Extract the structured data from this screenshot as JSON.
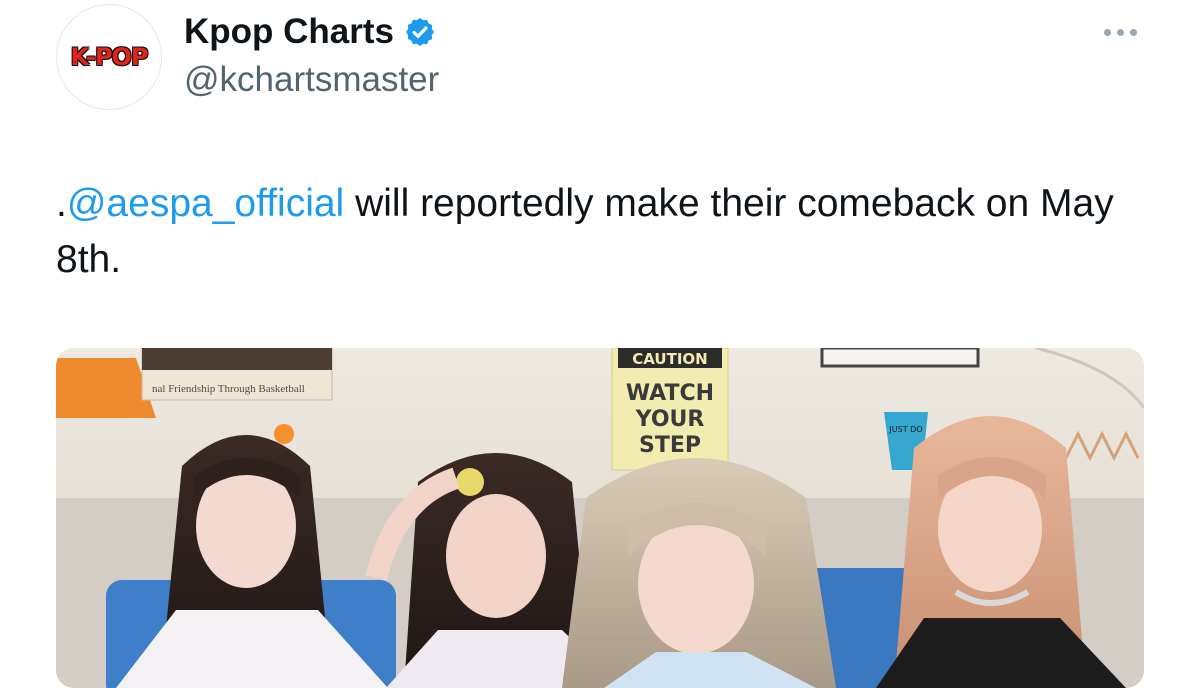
{
  "tweet": {
    "avatar_text": "K-POP",
    "display_name": "Kpop Charts",
    "handle": "@kchartsmaster",
    "text_prefix": ".",
    "mention": "@aespa_official",
    "text_rest": " will reportedly make their comeback on May 8th.",
    "icons": {
      "verified": "verified-badge-icon",
      "more": "more-options-icon"
    }
  },
  "media": {
    "sign_top": "CAUTION",
    "sign_main": "WATCH\nYOUR\nSTEP",
    "poster_text": "nal Friendship Through Basketball",
    "mug_text": "JUST DO"
  },
  "colors": {
    "link": "#1d9bf0",
    "secondary": "#536471",
    "verified": "#1d9bf0"
  }
}
